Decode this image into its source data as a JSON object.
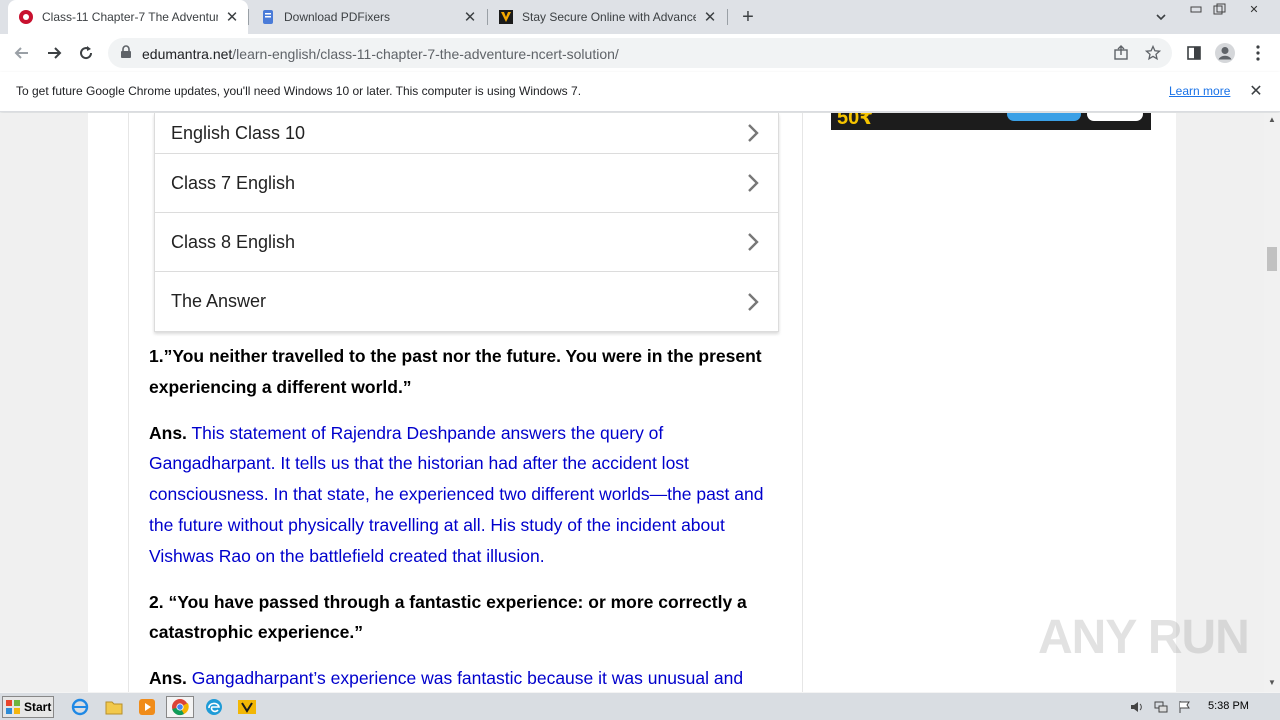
{
  "tabs": [
    {
      "title": "Class-11 Chapter-7 The Adventure-N",
      "active": true
    },
    {
      "title": "Download PDFixers",
      "active": false
    },
    {
      "title": "Stay Secure Online with Advanced A",
      "active": false
    }
  ],
  "omnibox": {
    "host": "edumantra.net",
    "path": "/learn-english/class-11-chapter-7-the-adventure-ncert-solution/"
  },
  "infobar": {
    "message": "To get future Google Chrome updates, you'll need Windows 10 or later. This computer is using Windows 7.",
    "link": "Learn more"
  },
  "menu_items": [
    {
      "label": "English Class 10"
    },
    {
      "label": "Class 7 English"
    },
    {
      "label": "Class 8 English"
    },
    {
      "label": "The Answer"
    }
  ],
  "article": {
    "q1": "1.”You neither travelled to the past nor the future. You were in the present experiencing a different world.”",
    "a1_label": "Ans.",
    "a1_text": " This statement of Rajendra Deshpande answers the query of Gangadharpant. It tells us that the historian had after the accident lost consciousness. In that state, he experienced two different worlds—the past and the future without physically travelling at all. His study of the incident about Vishwas Rao on the battlefield created that illusion.",
    "q2": "2. “You have passed through a fantastic experience: or more correctly a catastrophic experience.”",
    "a2_label": "Ans.",
    "a2_text": " Gangadharpant’s experience was fantastic because it was unusual and"
  },
  "watermark": "ANY RUN",
  "taskbar": {
    "start_label": "Start",
    "clock": "5:38 PM"
  },
  "colors": {
    "answer_text": "#0000cc",
    "link": "#1a73e8",
    "tab_strip": "#dee1e6"
  }
}
